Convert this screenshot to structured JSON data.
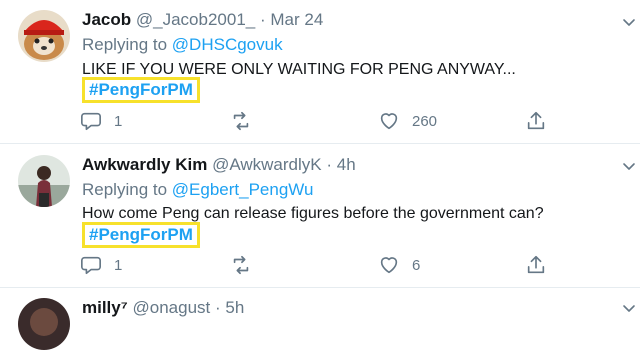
{
  "tweets": [
    {
      "name": "Jacob",
      "handle": "@_Jacob2001_",
      "dot": "·",
      "time": "Mar 24",
      "replying_prefix": "Replying to",
      "replying_to": "@DHSCgovuk",
      "text": "LIKE IF YOU WERE ONLY WAITING FOR PENG ANYWAY...",
      "hashtag": "#PengForPM",
      "replies": "1",
      "retweets": "",
      "likes": "260"
    },
    {
      "name": "Awkwardly Kim",
      "handle": "@AwkwardlyK",
      "dot": "·",
      "time": "4h",
      "replying_prefix": "Replying to",
      "replying_to": "@Egbert_PengWu",
      "text": "How come Peng can release figures before the government can?",
      "hashtag": "#PengForPM",
      "replies": "1",
      "retweets": "",
      "likes": "6"
    },
    {
      "name": "milly⁷",
      "handle": "@onagust",
      "dot": "·",
      "time": "5h"
    }
  ],
  "colors": {
    "accent": "#1da1f2",
    "highlight": "#f7e12b",
    "muted": "#657786"
  }
}
